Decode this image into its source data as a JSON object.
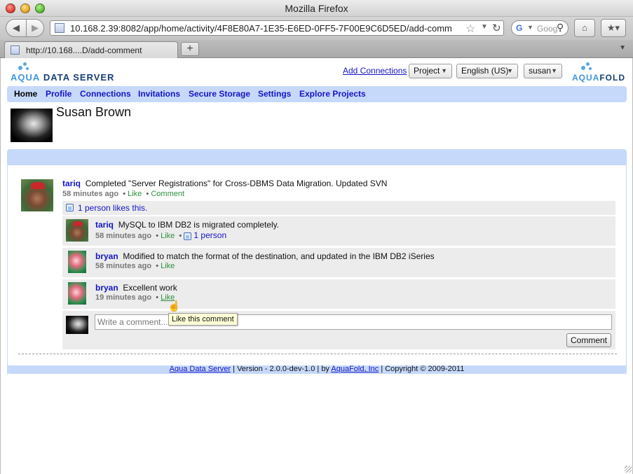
{
  "window": {
    "title": "Mozilla Firefox"
  },
  "browser": {
    "url": "10.168.2.39:8082/app/home/activity/4F8E80A7-1E35-E6ED-0FF5-7F00E9C6D5ED/add-comm",
    "search_placeholder": "Goog",
    "tab_label": "http://10.168....D/add-comment",
    "newtab_label": "+"
  },
  "header": {
    "logo_text_1": "AQUA",
    "logo_text_2": "DATA SERVER",
    "add_connections": "Add Connections",
    "project_select": "Project",
    "language_select": "English (US)",
    "user_select": "susan",
    "brand_1": "AQUA",
    "brand_2": "FOLD"
  },
  "menu": {
    "items": [
      "Home",
      "Profile",
      "Connections",
      "Invitations",
      "Secure Storage",
      "Settings",
      "Explore Projects"
    ]
  },
  "profile": {
    "name": "Susan Brown"
  },
  "activity": {
    "author": "tariq",
    "text": "Completed \"Server Registrations\" for Cross-DBMS Data Migration. Updated SVN",
    "time": "58 minutes ago",
    "like": "Like",
    "comment": "Comment",
    "likes_summary": "1 person likes this."
  },
  "comments": [
    {
      "author": "tariq",
      "text": "MySQL to IBM DB2 is migrated completely.",
      "time": "58 minutes ago",
      "like": "Like",
      "likes": "1 person"
    },
    {
      "author": "bryan",
      "text": "Modified to match the format of the destination, and updated in the IBM DB2 iSeries",
      "time": "58 minutes ago",
      "like": "Like"
    },
    {
      "author": "bryan",
      "text": "Excellent work",
      "time": "19 minutes ago",
      "like": "Like"
    }
  ],
  "composer": {
    "placeholder": "Write a comment...",
    "button": "Comment",
    "tooltip": "Like this comment"
  },
  "footer": {
    "product_link": "Aqua Data Server",
    "version": " | Version - 2.0.0-dev-1.0 | by ",
    "company_link": "AquaFold, Inc",
    "copyright": " | Copyright © 2009-2011"
  },
  "icons": {
    "back": "back-arrow-icon",
    "forward": "forward-arrow-icon",
    "reload": "reload-icon",
    "bookmark_star": "star-icon",
    "home": "home-icon",
    "search": "search-icon",
    "like": "thumbs-up-icon"
  }
}
